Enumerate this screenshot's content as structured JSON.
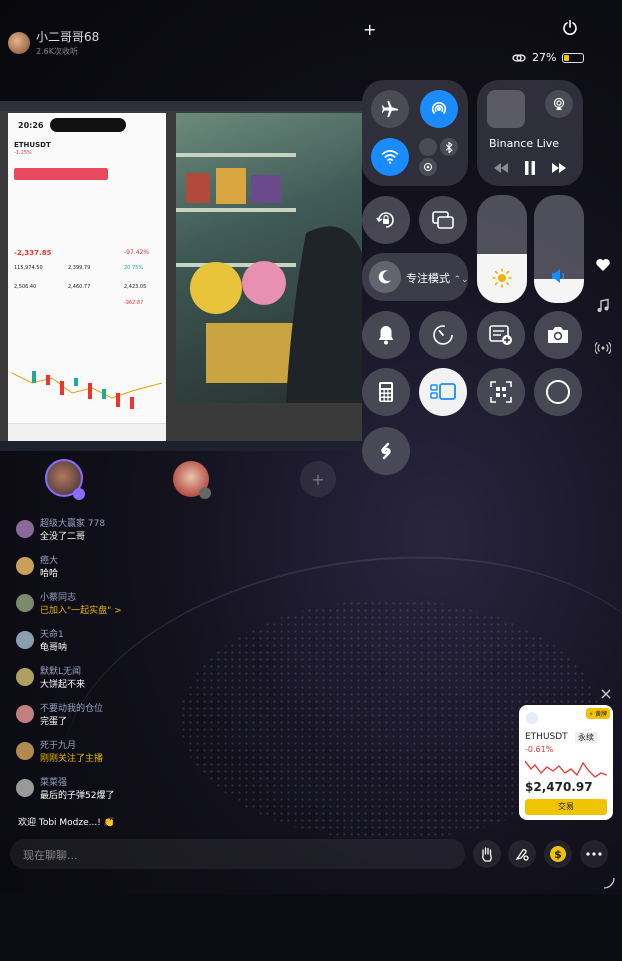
{
  "streamer": {
    "name": "小二哥哥68",
    "views": "2.6K次收听"
  },
  "status": {
    "battery": "27%",
    "battery_level": 0.27
  },
  "screen_share": {
    "time": "20:26",
    "pair": "ETHUSDT",
    "pair_change": "-1.25%",
    "pnl": "-2,337.85",
    "ratio": "-97.42%",
    "val1": "115,974.50",
    "val2": "2,399.79",
    "val3": "20.75%",
    "val4": "2,506.40",
    "val5": "2,460.77",
    "val6": "2,423.05",
    "loss": "-962.87"
  },
  "control_center": {
    "media_title": "Binance Live",
    "focus_label": "专注模式",
    "brightness_level": 0.45,
    "volume_level": 0.22
  },
  "chat": {
    "messages": [
      {
        "user": "超级大赢家 778",
        "text": "全没了二哥",
        "gold": false,
        "color": "#8a6a9a"
      },
      {
        "user": "癌大",
        "text": "哈哈",
        "gold": false,
        "color": "#c9a05a"
      },
      {
        "user": "小蔡同志",
        "text": "已加入\"一起实盘\" >",
        "gold": true,
        "color": "#7a8a6a"
      },
      {
        "user": "天命1",
        "text": "龟哥呐",
        "gold": false,
        "color": "#8aa0b0"
      },
      {
        "user": "默默L无闻",
        "text": "大饼起不来",
        "gold": false,
        "color": "#b0a060"
      },
      {
        "user": "不要动我的仓位",
        "text": "完蛋了",
        "gold": false,
        "color": "#c08080"
      },
      {
        "user": "死于九月",
        "text": "刚刚关注了主播",
        "gold": true,
        "color": "#b08a50"
      },
      {
        "user": "菜菜强",
        "text": "最后的子弹52爆了",
        "gold": false,
        "color": "#999"
      }
    ],
    "welcome": "欢迎 Tobi Modze...! 👏"
  },
  "eth_card": {
    "badge": "⚡ 黄牌",
    "symbol": "ETHUSDT",
    "type": "永续",
    "change": "-0.61%",
    "price": "$2,470.97",
    "trade": "交易"
  },
  "input": {
    "placeholder": "现在聊聊..."
  }
}
